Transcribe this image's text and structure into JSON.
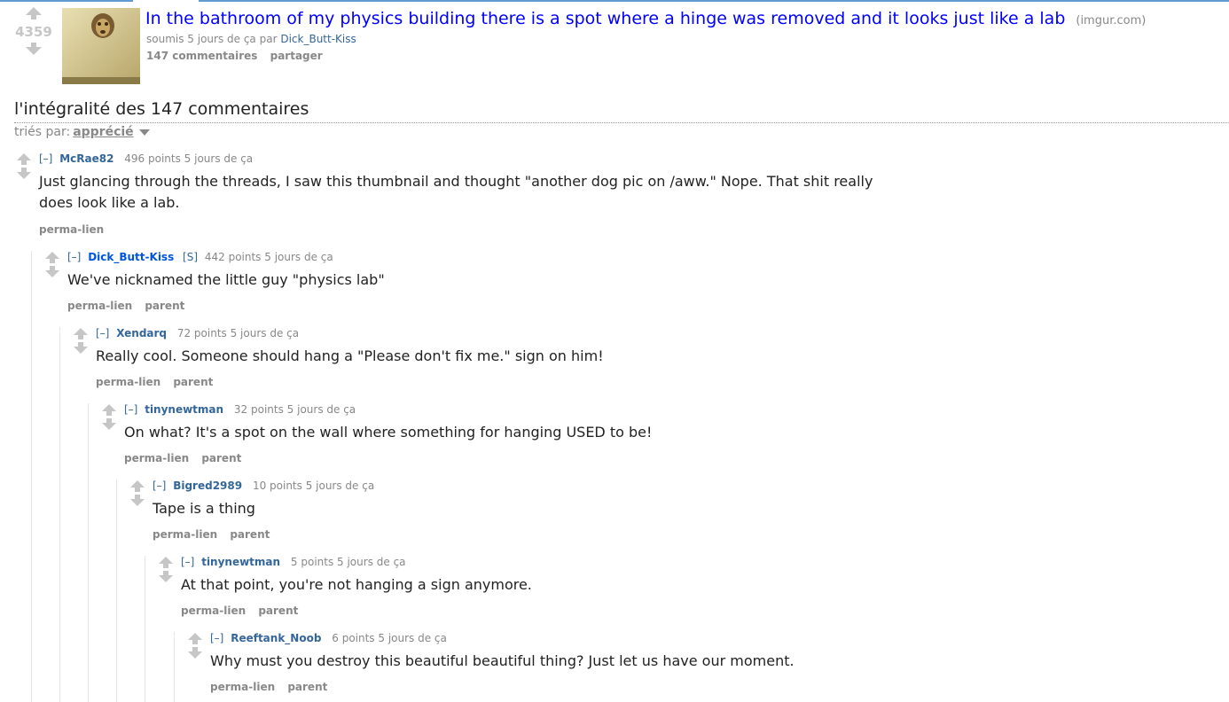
{
  "post": {
    "score": "4359",
    "title": "In the bathroom of my physics building there is a spot where a hinge was removed and it looks just like a lab",
    "domain": "(imgur.com)",
    "tagline_prefix": "soumis 5 jours de ça par",
    "author": "Dick_Butt-Kiss",
    "comments_link": "147 commentaires",
    "share_link": "partager"
  },
  "all_comments_label": "l'intégralité des 147 commentaires",
  "sort": {
    "label": "triés par:",
    "value": "apprécié"
  },
  "comments": [
    {
      "toggle": "[–]",
      "author": "McRae82",
      "submitter": "",
      "meta": "496 points 5 jours de ça",
      "body_lines": [
        "Just glancing through the threads, I saw this thumbnail and thought \"another dog pic on /aww.\" Nope. That shit really",
        "does look like a lab."
      ],
      "buttons": [
        "perma-lien"
      ]
    },
    {
      "toggle": "[–]",
      "author": "Dick_Butt-Kiss",
      "submitter": "[S]",
      "meta": "442 points 5 jours de ça",
      "body_lines": [
        "We've nicknamed the little guy \"physics lab\""
      ],
      "buttons": [
        "perma-lien",
        "parent"
      ]
    },
    {
      "toggle": "[–]",
      "author": "Xendarq",
      "submitter": "",
      "meta": "72 points 5 jours de ça",
      "body_lines": [
        "Really cool. Someone should hang a \"Please don't fix me.\" sign on him!"
      ],
      "buttons": [
        "perma-lien",
        "parent"
      ]
    },
    {
      "toggle": "[–]",
      "author": "tinynewtman",
      "submitter": "",
      "meta": "32 points 5 jours de ça",
      "body_lines": [
        "On what? It's a spot on the wall where something for hanging USED to be!"
      ],
      "buttons": [
        "perma-lien",
        "parent"
      ]
    },
    {
      "toggle": "[–]",
      "author": "Bigred2989",
      "submitter": "",
      "meta": "10 points 5 jours de ça",
      "body_lines": [
        "Tape is a thing"
      ],
      "buttons": [
        "perma-lien",
        "parent"
      ]
    },
    {
      "toggle": "[–]",
      "author": "tinynewtman",
      "submitter": "",
      "meta": "5 points 5 jours de ça",
      "body_lines": [
        "At that point, you're not hanging a sign anymore."
      ],
      "buttons": [
        "perma-lien",
        "parent"
      ]
    },
    {
      "toggle": "[–]",
      "author": "Reeftank_Noob",
      "submitter": "",
      "meta": "6 points 5 jours de ça",
      "body_lines": [
        "Why must you destroy this beautiful beautiful thing? Just let us have our moment."
      ],
      "buttons": [
        "perma-lien",
        "parent"
      ]
    }
  ]
}
